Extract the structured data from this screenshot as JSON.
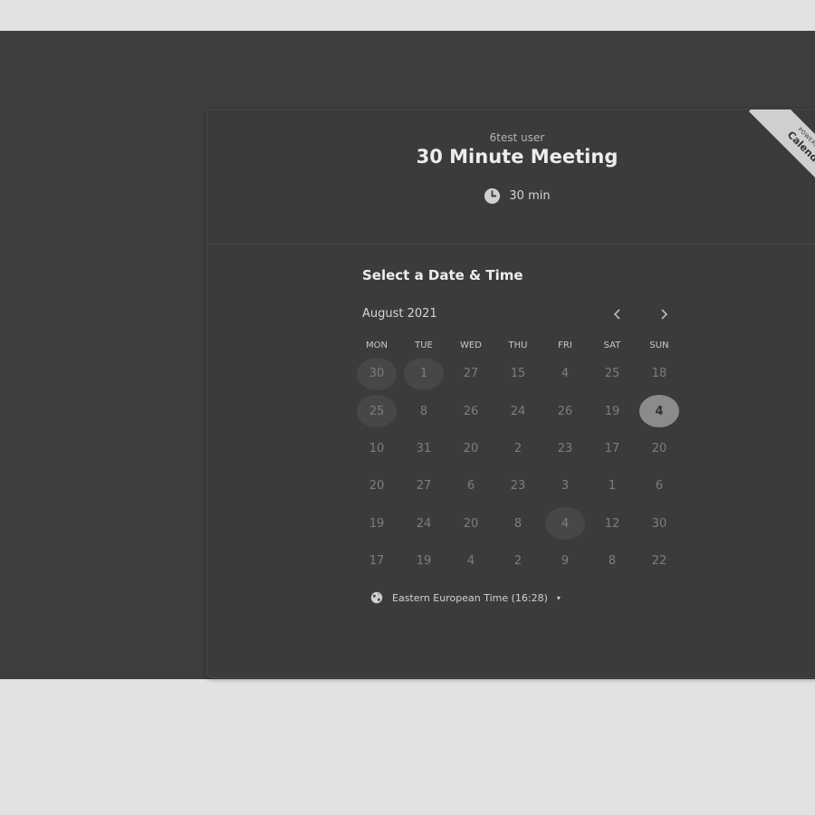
{
  "header": {
    "organizer": "6test user",
    "event_title": "30 Minute Meeting",
    "duration": "30 min",
    "duration_icon": "clock-icon"
  },
  "ribbon": {
    "small": "POWERED BY",
    "brand": "Calendly"
  },
  "scheduler": {
    "title": "Select a Date & Time",
    "month": "August 2021",
    "prev_icon": "chevron-left-icon",
    "next_icon": "chevron-right-icon",
    "weekdays": [
      "MON",
      "TUE",
      "WED",
      "THU",
      "FRI",
      "SAT",
      "SUN"
    ],
    "weeks": [
      [
        "30",
        "1",
        "27",
        "15",
        "4",
        "25",
        "18"
      ],
      [
        "25",
        "8",
        "26",
        "24",
        "26",
        "19",
        "4"
      ],
      [
        "10",
        "31",
        "20",
        "2",
        "23",
        "17",
        "20"
      ],
      [
        "20",
        "27",
        "6",
        "23",
        "3",
        "1",
        "6"
      ],
      [
        "19",
        "24",
        "20",
        "8",
        "4",
        "12",
        "30"
      ],
      [
        "17",
        "19",
        "4",
        "2",
        "9",
        "8",
        "22"
      ]
    ],
    "available_days": [
      "0-0",
      "0-1",
      "1-0",
      "4-4"
    ],
    "selected_day": "1-6",
    "timezone": "Eastern European Time (16:28)",
    "timezone_icon": "globe-icon",
    "timezone_caret": "▾"
  },
  "colors": {
    "page_bg": "#e2e2e2",
    "stage_bg": "#3e3e3e",
    "card_bg": "#3b3b3b",
    "selected_bg": "#8b8b8b"
  }
}
